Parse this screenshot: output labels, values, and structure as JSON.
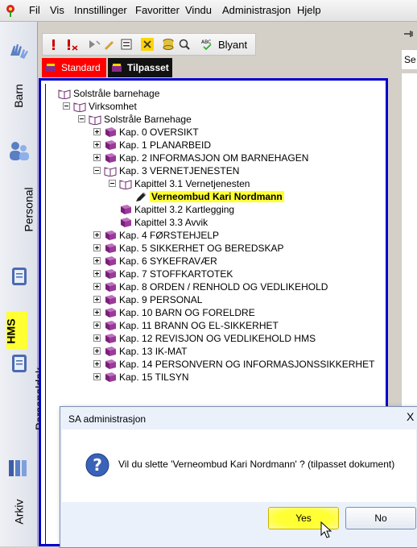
{
  "menubar": {
    "items": [
      "Fil",
      "Vis",
      "Innstillinger",
      "Favoritter",
      "Vindu",
      "Administrasjon",
      "Hjelp"
    ]
  },
  "leftbar": {
    "items": [
      "Barn",
      "Personal",
      "HMS",
      "Personaldok.",
      "Arkiv"
    ]
  },
  "toolbar": {
    "text_button": "Blyant"
  },
  "tabs": [
    {
      "label": "Standard"
    },
    {
      "label": "Tilpasset"
    }
  ],
  "tree": [
    {
      "label": "Solstråle barnehage",
      "level": 0,
      "expander": "none",
      "icon": "book-open"
    },
    {
      "label": "Virksomhet",
      "level": 1,
      "expander": "minus",
      "icon": "book-open"
    },
    {
      "label": "Solstråle Barnehage",
      "level": 2,
      "expander": "minus",
      "icon": "book-open"
    },
    {
      "label": "Kap. 0  OVERSIKT",
      "level": 3,
      "expander": "plus",
      "icon": "book"
    },
    {
      "label": "Kap. 1   PLANARBEID",
      "level": 3,
      "expander": "plus",
      "icon": "book"
    },
    {
      "label": "Kap. 2   INFORMASJON OM BARNEHAGEN",
      "level": 3,
      "expander": "plus",
      "icon": "book"
    },
    {
      "label": "Kap. 3   VERNETJENESTEN",
      "level": 3,
      "expander": "minus",
      "icon": "book-open"
    },
    {
      "label": "Kapittel 3.1 Vernetjenesten",
      "level": 4,
      "expander": "minus",
      "icon": "book-open"
    },
    {
      "label": "Verneombud Kari Nordmann",
      "level": 5,
      "expander": "none",
      "icon": "pencil",
      "selected": true
    },
    {
      "label": "Kapittel 3.2 Kartlegging",
      "level": 4,
      "expander": "none",
      "icon": "book"
    },
    {
      "label": "Kapittel 3.3 Avvik",
      "level": 4,
      "expander": "none",
      "icon": "book"
    },
    {
      "label": "Kap. 4   FØRSTEHJELP",
      "level": 3,
      "expander": "plus",
      "icon": "book"
    },
    {
      "label": "Kap. 5  SIKKERHET OG BEREDSKAP",
      "level": 3,
      "expander": "plus",
      "icon": "book"
    },
    {
      "label": "Kap. 6   SYKEFRAVÆR",
      "level": 3,
      "expander": "plus",
      "icon": "book"
    },
    {
      "label": "Kap. 7   STOFFKARTOTEK",
      "level": 3,
      "expander": "plus",
      "icon": "book"
    },
    {
      "label": "Kap. 8   ORDEN / RENHOLD OG VEDLIKEHOLD",
      "level": 3,
      "expander": "plus",
      "icon": "book"
    },
    {
      "label": "Kap. 9   PERSONAL",
      "level": 3,
      "expander": "plus",
      "icon": "book"
    },
    {
      "label": "Kap. 10 BARN OG FORELDRE",
      "level": 3,
      "expander": "plus",
      "icon": "book"
    },
    {
      "label": "Kap. 11 BRANN OG EL-SIKKERHET",
      "level": 3,
      "expander": "plus",
      "icon": "book"
    },
    {
      "label": "Kap. 12 REVISJON OG VEDLIKEHOLD HMS",
      "level": 3,
      "expander": "plus",
      "icon": "book"
    },
    {
      "label": "Kap. 13 IK-MAT",
      "level": 3,
      "expander": "plus",
      "icon": "book"
    },
    {
      "label": "Kap. 14  PERSONVERN OG INFORMASJONSSIKKERHET",
      "level": 3,
      "expander": "plus",
      "icon": "book"
    },
    {
      "label": "Kap. 15 TILSYN",
      "level": 3,
      "expander": "plus",
      "icon": "book"
    }
  ],
  "right_panel": {
    "field_text": "Se"
  },
  "dialog": {
    "title": "SA administrasjon",
    "close_glyph": "X",
    "message": "Vil du slette 'Verneombud Kari Nordmann' ? (tilpasset dokument)",
    "yes_label": "Yes",
    "no_label": "No"
  },
  "colors": {
    "tree_border": "#0000cc",
    "selection_highlight": "#ffff33",
    "tab_standard": "#ff0000",
    "tab_tilpasset": "#111111",
    "book": "#8a2a8a"
  }
}
